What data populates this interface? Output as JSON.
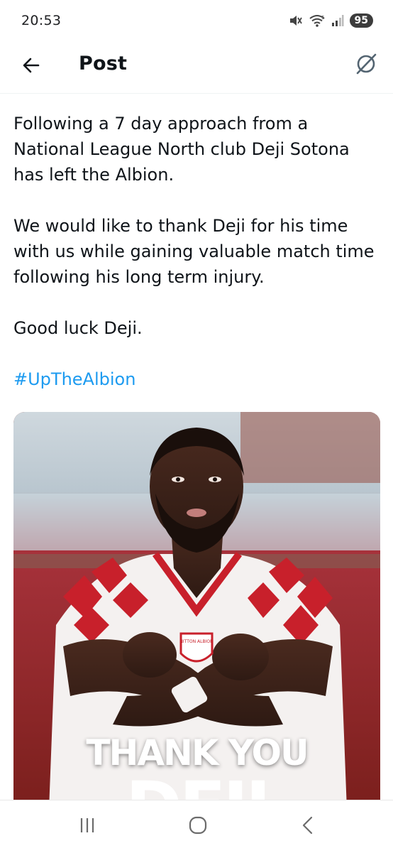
{
  "status_bar": {
    "time": "20:53",
    "battery": "95",
    "icons": [
      "mute-icon",
      "wifi-icon",
      "signal-icon"
    ]
  },
  "header": {
    "title": "Post",
    "back_icon": "arrow-left-icon",
    "grok_icon": "grok-icon"
  },
  "tweet": {
    "paragraphs": [
      "Following a 7 day approach from a National League North club Deji Sotona has left the Albion.",
      "We would like to thank Deji for his time with us while gaining valuable match time following his long term injury.",
      "Good luck Deji."
    ],
    "hashtag": "#UpTheAlbion",
    "link_color": "#1d9bf0"
  },
  "media": {
    "headline": "THANK YOU",
    "name": "DEJI",
    "kit_colors": [
      "#c8202b",
      "#ffffff"
    ]
  },
  "nav_bar": {
    "icons": [
      "recent-apps-icon",
      "home-icon",
      "back-icon"
    ]
  }
}
